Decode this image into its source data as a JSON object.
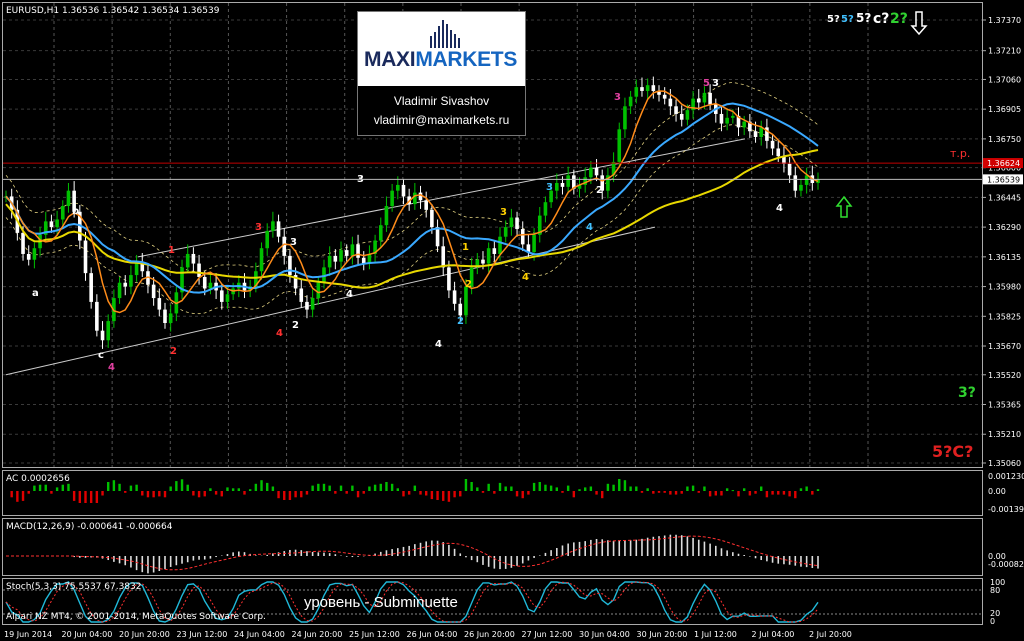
{
  "header": {
    "symbol_info": "EURUSD,H1  1.36536 1.36542 1.36534 1.36539",
    "ac_label": "AC 0.0002656",
    "macd_label": "MACD(12,26,9) -0.000641 -0.000664",
    "stoch_label": "Stoch(5,3,3) 75.5537 67.3832",
    "copyright": "Alpari NZ MT4, © 2001-2014, MetaQuotes Software Corp."
  },
  "logo": {
    "brand_part1": "MAXI",
    "brand_part2": "MARKETS",
    "author": "Vladimir Sivashov",
    "email": "vladimir@maximarkets.ru"
  },
  "caption": "уровень - Subminuette",
  "top_right_labels": {
    "l1": "5?",
    "l2": "5?",
    "l3": "5?",
    "l4": "c?",
    "l5": "2?"
  },
  "side_labels": {
    "target": "т.р.",
    "three": "3?",
    "fivec": "5?C?"
  },
  "colors": {
    "background": "#000000",
    "bull_candle": "#00c000",
    "bear_candle": "#ffffff",
    "ma_fast": "#ff8c1a",
    "ma_mid": "#3aa9ff",
    "ma_slow": "#e8d800",
    "resistance": "#c00000",
    "channel": "#cccccc",
    "wave_red": "#ff3030",
    "wave_magenta": "#e040a0",
    "wave_yellow": "#ffd000",
    "wave_cyan": "#40c0ff"
  },
  "chart_data": {
    "type": "candlestick",
    "symbol": "EURUSD",
    "timeframe": "H1",
    "last_price": 1.36539,
    "resistance_price": 1.36624,
    "y_ticks": [
      "1.37370",
      "1.37210",
      "1.37060",
      "1.36905",
      "1.36750",
      "1.36600",
      "1.36445",
      "1.36290",
      "1.36135",
      "1.35980",
      "1.35825",
      "1.35670",
      "1.35520",
      "1.35365",
      "1.35210",
      "1.35060"
    ],
    "price_tags": [
      "1.36624",
      "1.36539"
    ],
    "x_ticks": [
      "19 Jun 2014",
      "20 Jun 04:00",
      "20 Jun 20:00",
      "23 Jun 12:00",
      "24 Jun 04:00",
      "24 Jun 20:00",
      "25 Jun 12:00",
      "26 Jun 04:00",
      "26 Jun 20:00",
      "27 Jun 12:00",
      "30 Jun 04:00",
      "30 Jun 20:00",
      "1 Jul 12:00",
      "2 Jul 04:00",
      "2 Jul 20:00"
    ],
    "ac_ticks": [
      "0.001230",
      "0.00",
      "-0.001394"
    ],
    "macd_ticks": [
      "0.00",
      "-0.000827"
    ],
    "stoch_ticks": [
      "100",
      "80",
      "20",
      "0"
    ],
    "close_series": [
      1.3645,
      1.3638,
      1.3626,
      1.3615,
      1.3612,
      1.3618,
      1.3625,
      1.3632,
      1.3629,
      1.3633,
      1.364,
      1.3648,
      1.3637,
      1.3622,
      1.3605,
      1.359,
      1.3575,
      1.357,
      1.358,
      1.3592,
      1.36,
      1.3598,
      1.3604,
      1.3611,
      1.3606,
      1.3599,
      1.3592,
      1.3586,
      1.3579,
      1.3584,
      1.3595,
      1.3608,
      1.3615,
      1.361,
      1.3603,
      1.3597,
      1.36,
      1.3596,
      1.359,
      1.3594,
      1.3597,
      1.36,
      1.3596,
      1.3598,
      1.3606,
      1.3618,
      1.3627,
      1.3632,
      1.3624,
      1.3614,
      1.3604,
      1.3597,
      1.359,
      1.3586,
      1.3592,
      1.36,
      1.3608,
      1.3614,
      1.3611,
      1.3617,
      1.3614,
      1.362,
      1.3613,
      1.361,
      1.3615,
      1.3622,
      1.363,
      1.364,
      1.3648,
      1.3651,
      1.3645,
      1.3641,
      1.3647,
      1.3643,
      1.3638,
      1.3629,
      1.3619,
      1.3608,
      1.3596,
      1.3589,
      1.3583,
      1.3598,
      1.3608,
      1.3612,
      1.361,
      1.3618,
      1.3615,
      1.3624,
      1.3629,
      1.3634,
      1.3628,
      1.362,
      1.3616,
      1.3625,
      1.3635,
      1.3642,
      1.3648,
      1.3652,
      1.365,
      1.3656,
      1.3649,
      1.3651,
      1.3655,
      1.366,
      1.3656,
      1.3648,
      1.3656,
      1.3663,
      1.368,
      1.3692,
      1.3697,
      1.3702,
      1.37,
      1.3703,
      1.37,
      1.3698,
      1.3696,
      1.3692,
      1.3688,
      1.3685,
      1.369,
      1.3696,
      1.3694,
      1.3699,
      1.3693,
      1.3688,
      1.3683,
      1.3686,
      1.3687,
      1.3681,
      1.3684,
      1.3679,
      1.3676,
      1.3681,
      1.3674,
      1.367,
      1.3666,
      1.3662,
      1.3656,
      1.3648,
      1.3651,
      1.3656,
      1.3652,
      1.3654
    ]
  }
}
